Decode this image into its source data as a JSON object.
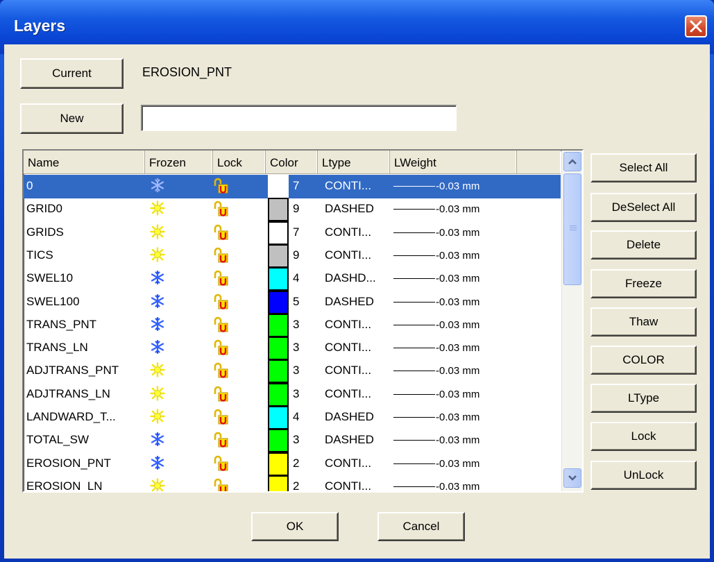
{
  "window": {
    "title": "Layers"
  },
  "top": {
    "current_button": "Current",
    "current_value": "EROSION_PNT",
    "new_button": "New",
    "new_input_value": ""
  },
  "table": {
    "columns": [
      "Name",
      "Frozen",
      "Lock",
      "Color",
      "Ltype",
      "LWeight"
    ],
    "rows": [
      {
        "name": "0",
        "frozen": "frozen",
        "lock": "unlocked",
        "color": "#ffffff",
        "color_num": "7",
        "ltype": "CONTI...",
        "lweight": "-0.03 mm",
        "selected": true
      },
      {
        "name": "GRID0",
        "frozen": "thawed",
        "lock": "unlocked",
        "color": "#c0c0c0",
        "color_num": "9",
        "ltype": "DASHED",
        "lweight": "-0.03 mm"
      },
      {
        "name": "GRIDS",
        "frozen": "thawed",
        "lock": "unlocked",
        "color": "#ffffff",
        "color_num": "7",
        "ltype": "CONTI...",
        "lweight": "-0.03 mm"
      },
      {
        "name": "TICS",
        "frozen": "thawed",
        "lock": "unlocked",
        "color": "#c0c0c0",
        "color_num": "9",
        "ltype": "CONTI...",
        "lweight": "-0.03 mm"
      },
      {
        "name": "SWEL10",
        "frozen": "frozen",
        "lock": "unlocked",
        "color": "#00ffff",
        "color_num": "4",
        "ltype": "DASHD...",
        "lweight": "-0.03 mm"
      },
      {
        "name": "SWEL100",
        "frozen": "frozen",
        "lock": "unlocked",
        "color": "#0000ff",
        "color_num": "5",
        "ltype": "DASHED",
        "lweight": "-0.03 mm"
      },
      {
        "name": "TRANS_PNT",
        "frozen": "frozen",
        "lock": "unlocked",
        "color": "#00ff00",
        "color_num": "3",
        "ltype": "CONTI...",
        "lweight": "-0.03 mm"
      },
      {
        "name": "TRANS_LN",
        "frozen": "frozen",
        "lock": "unlocked",
        "color": "#00ff00",
        "color_num": "3",
        "ltype": "CONTI...",
        "lweight": "-0.03 mm"
      },
      {
        "name": "ADJTRANS_PNT",
        "frozen": "thawed",
        "lock": "unlocked",
        "color": "#00ff00",
        "color_num": "3",
        "ltype": "CONTI...",
        "lweight": "-0.03 mm"
      },
      {
        "name": "ADJTRANS_LN",
        "frozen": "thawed",
        "lock": "unlocked",
        "color": "#00ff00",
        "color_num": "3",
        "ltype": "CONTI...",
        "lweight": "-0.03 mm"
      },
      {
        "name": "LANDWARD_T...",
        "frozen": "thawed",
        "lock": "unlocked",
        "color": "#00ffff",
        "color_num": "4",
        "ltype": "DASHED",
        "lweight": "-0.03 mm"
      },
      {
        "name": "TOTAL_SW",
        "frozen": "frozen",
        "lock": "unlocked",
        "color": "#00ff00",
        "color_num": "3",
        "ltype": "DASHED",
        "lweight": "-0.03 mm"
      },
      {
        "name": "EROSION_PNT",
        "frozen": "frozen",
        "lock": "unlocked",
        "color": "#ffff00",
        "color_num": "2",
        "ltype": "CONTI...",
        "lweight": "-0.03 mm"
      },
      {
        "name": "EROSION_LN",
        "frozen": "thawed",
        "lock": "unlocked",
        "color": "#ffff00",
        "color_num": "2",
        "ltype": "CONTI...",
        "lweight": "-0.03 mm"
      },
      {
        "name": "",
        "frozen": "thawed",
        "lock": "unlocked",
        "color": "#ffff00",
        "color_num": "",
        "ltype": "",
        "lweight": ""
      }
    ]
  },
  "side_buttons": [
    "Select All",
    "DeSelect All",
    "Delete",
    "Freeze",
    "Thaw",
    "COLOR",
    "LType",
    "Lock",
    "UnLock"
  ],
  "footer": {
    "ok": "OK",
    "cancel": "Cancel"
  },
  "colors": {
    "selection": "#316ac5",
    "dialog_bg": "#ece9d8",
    "title_blue": "#0a45d4"
  }
}
